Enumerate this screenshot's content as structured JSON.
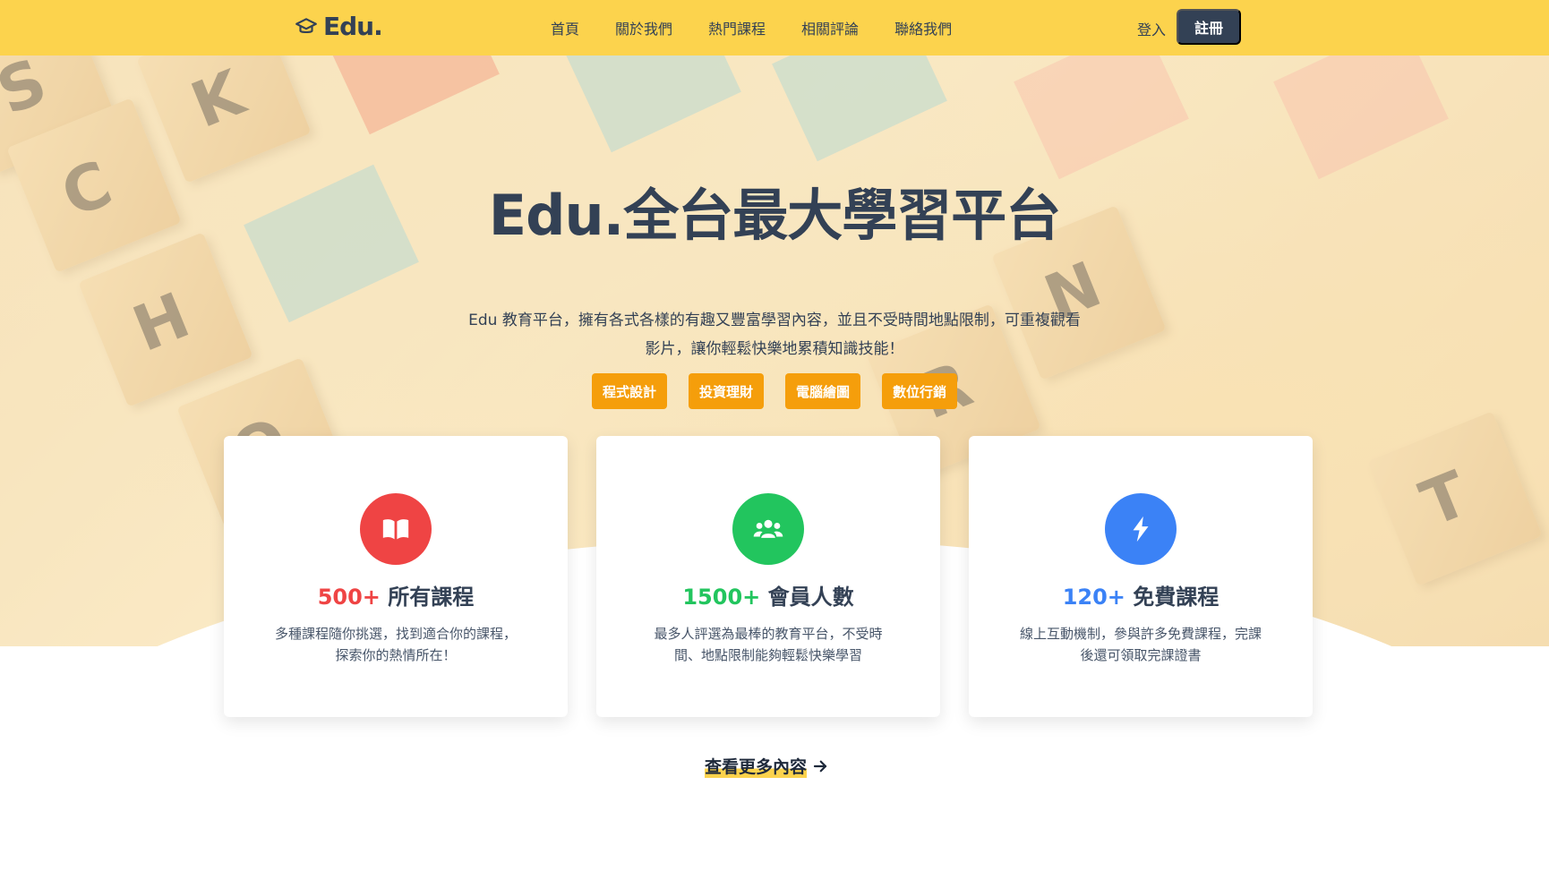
{
  "navbar": {
    "logo_text": "Edu.",
    "links": [
      "首頁",
      "關於我們",
      "熱門課程",
      "相關評論",
      "聯絡我們"
    ],
    "login_label": "登入",
    "signup_label": "註冊",
    "bg_color": "#fcd34d"
  },
  "hero": {
    "title": "Edu.全台最大學習平台",
    "description": "Edu 教育平台，擁有各式各樣的有趣又豐富學習內容，並且不受時間地點限制，可重複觀看影片，讓你輕鬆快樂地累積知識技能！",
    "tags": [
      "程式設計",
      "投資理財",
      "電腦繪圖",
      "數位行銷"
    ],
    "tag_color": "#f59e0b"
  },
  "features": [
    {
      "icon": "book-icon",
      "color": "#ef4444",
      "number": "500+",
      "label": "所有課程",
      "description": "多種課程隨你挑選，找到適合你的課程，探索你的熱情所在！"
    },
    {
      "icon": "users-icon",
      "color": "#22c55e",
      "number": "1500+",
      "label": "會員人數",
      "description": "最多人評選為最棒的教育平台，不受時間、地點限制能夠輕鬆快樂學習"
    },
    {
      "icon": "lightning-icon",
      "color": "#3b82f6",
      "number": "120+",
      "label": "免費課程",
      "description": "線上互動機制，參與許多免費課程，完課後還可領取完課證書"
    }
  ],
  "more_link": {
    "label": "查看更多內容"
  }
}
